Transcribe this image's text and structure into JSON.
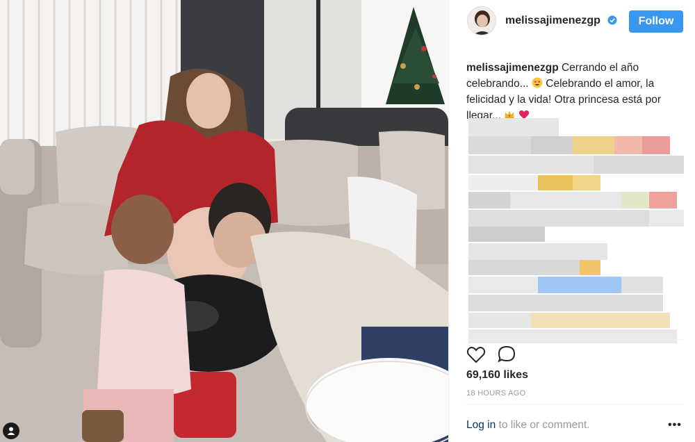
{
  "post": {
    "username": "melissajimenezgp",
    "follow_label": "Follow",
    "caption_user": "melissajimenezgp",
    "caption_text_1": "Cerrando el año celebrando...",
    "caption_text_2": "Celebrando el amor, la felicidad y la vida! Otra princesa está por llegar...",
    "likes": "69,160 likes",
    "timestamp": "18 HOURS AGO",
    "login_link": "Log in",
    "login_suffix": " to like or comment.",
    "more_label": "•••"
  },
  "icons": {
    "avatar": "profile-avatar",
    "verified": "verified-badge-icon",
    "like": "heart-icon",
    "comment": "speech-bubble-icon",
    "emoji_1": "heart-eyes-emoji",
    "emoji_2": "crown-emoji",
    "emoji_3": "red-heart-emoji",
    "corner": "person-icon"
  },
  "colors": {
    "accent": "#3897f0",
    "link": "#003569",
    "muted": "#999999",
    "text": "#262626"
  }
}
